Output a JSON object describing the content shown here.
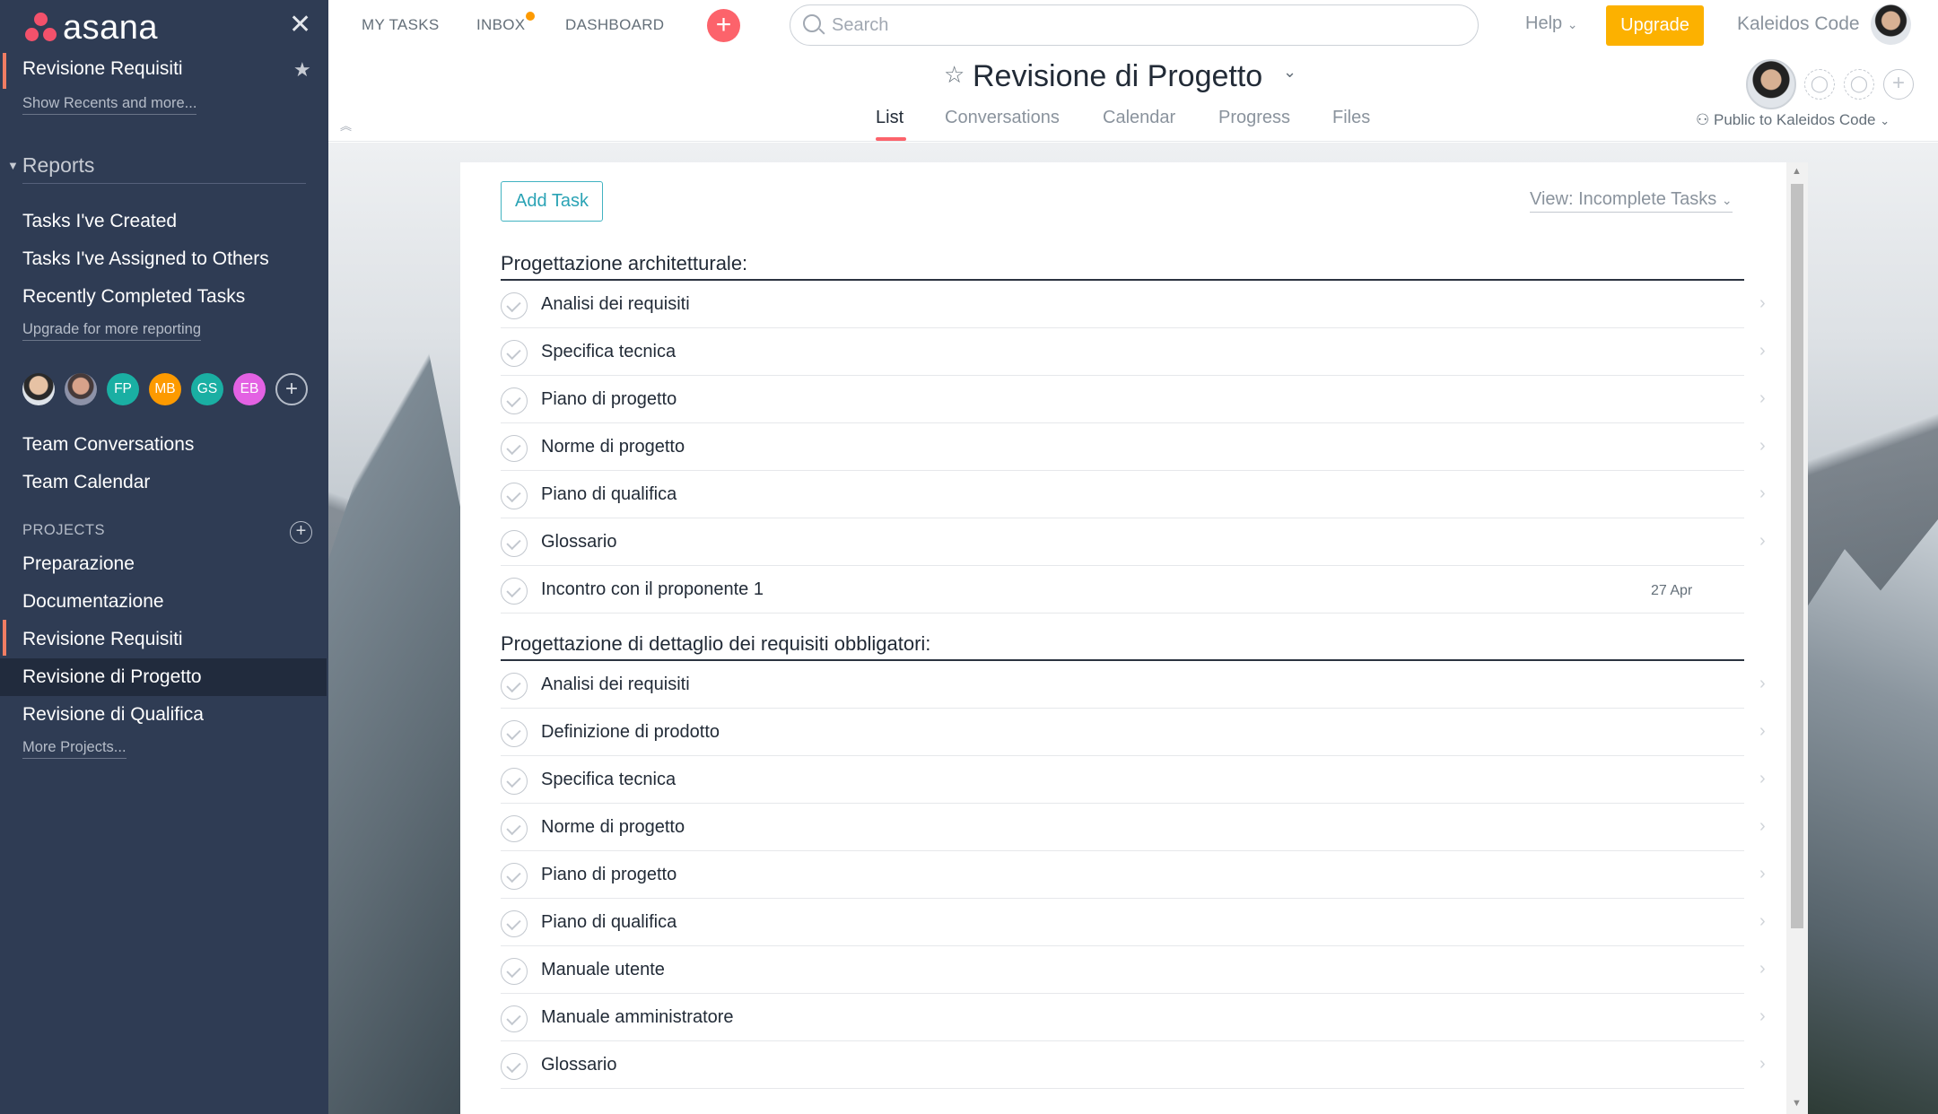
{
  "sidebar": {
    "logo_text": "asana",
    "recent_project": "Revisione Requisiti",
    "show_recents": "Show Recents and more...",
    "reports_heading": "Reports",
    "reports": [
      "Tasks I've Created",
      "Tasks I've Assigned to Others",
      "Recently Completed Tasks"
    ],
    "upgrade_reporting": "Upgrade for more reporting",
    "team_members": [
      {
        "initials": "",
        "color": ""
      },
      {
        "initials": "",
        "color": ""
      },
      {
        "initials": "FP",
        "color": "#1aafa3"
      },
      {
        "initials": "MB",
        "color": "#fd9a00"
      },
      {
        "initials": "GS",
        "color": "#1aafa3"
      },
      {
        "initials": "EB",
        "color": "#e362e3"
      }
    ],
    "team_conversations": "Team Conversations",
    "team_calendar": "Team Calendar",
    "projects_heading": "PROJECTS",
    "projects": [
      "Preparazione",
      "Documentazione",
      "Revisione Requisiti",
      "Revisione di Progetto",
      "Revisione di Qualifica"
    ],
    "more_projects": "More Projects..."
  },
  "topbar": {
    "my_tasks": "MY TASKS",
    "inbox": "INBOX",
    "dashboard": "DASHBOARD",
    "search_placeholder": "Search",
    "help": "Help",
    "upgrade": "Upgrade",
    "user_name": "Kaleidos Code"
  },
  "project": {
    "title": "Revisione di Progetto",
    "tabs": [
      "List",
      "Conversations",
      "Calendar",
      "Progress",
      "Files"
    ],
    "active_tab": "List",
    "privacy": "Public to Kaleidos Code"
  },
  "list": {
    "add_task": "Add Task",
    "view_filter": "View: Incomplete Tasks",
    "sections": [
      {
        "title": "Progettazione architetturale:",
        "tasks": [
          {
            "name": "Analisi dei requisiti",
            "due": ""
          },
          {
            "name": "Specifica tecnica",
            "due": ""
          },
          {
            "name": "Piano di progetto",
            "due": ""
          },
          {
            "name": "Norme di progetto",
            "due": ""
          },
          {
            "name": "Piano di qualifica",
            "due": ""
          },
          {
            "name": "Glossario",
            "due": ""
          },
          {
            "name": "Incontro con il proponente 1",
            "due": "27 Apr"
          }
        ]
      },
      {
        "title": "Progettazione di dettaglio dei requisiti obbligatori:",
        "tasks": [
          {
            "name": "Analisi dei requisiti",
            "due": ""
          },
          {
            "name": "Definizione di prodotto",
            "due": ""
          },
          {
            "name": "Specifica tecnica",
            "due": ""
          },
          {
            "name": "Norme di progetto",
            "due": ""
          },
          {
            "name": "Piano di progetto",
            "due": ""
          },
          {
            "name": "Piano di qualifica",
            "due": ""
          },
          {
            "name": "Manuale utente",
            "due": ""
          },
          {
            "name": "Manuale amministratore",
            "due": ""
          },
          {
            "name": "Glossario",
            "due": ""
          }
        ]
      }
    ]
  }
}
